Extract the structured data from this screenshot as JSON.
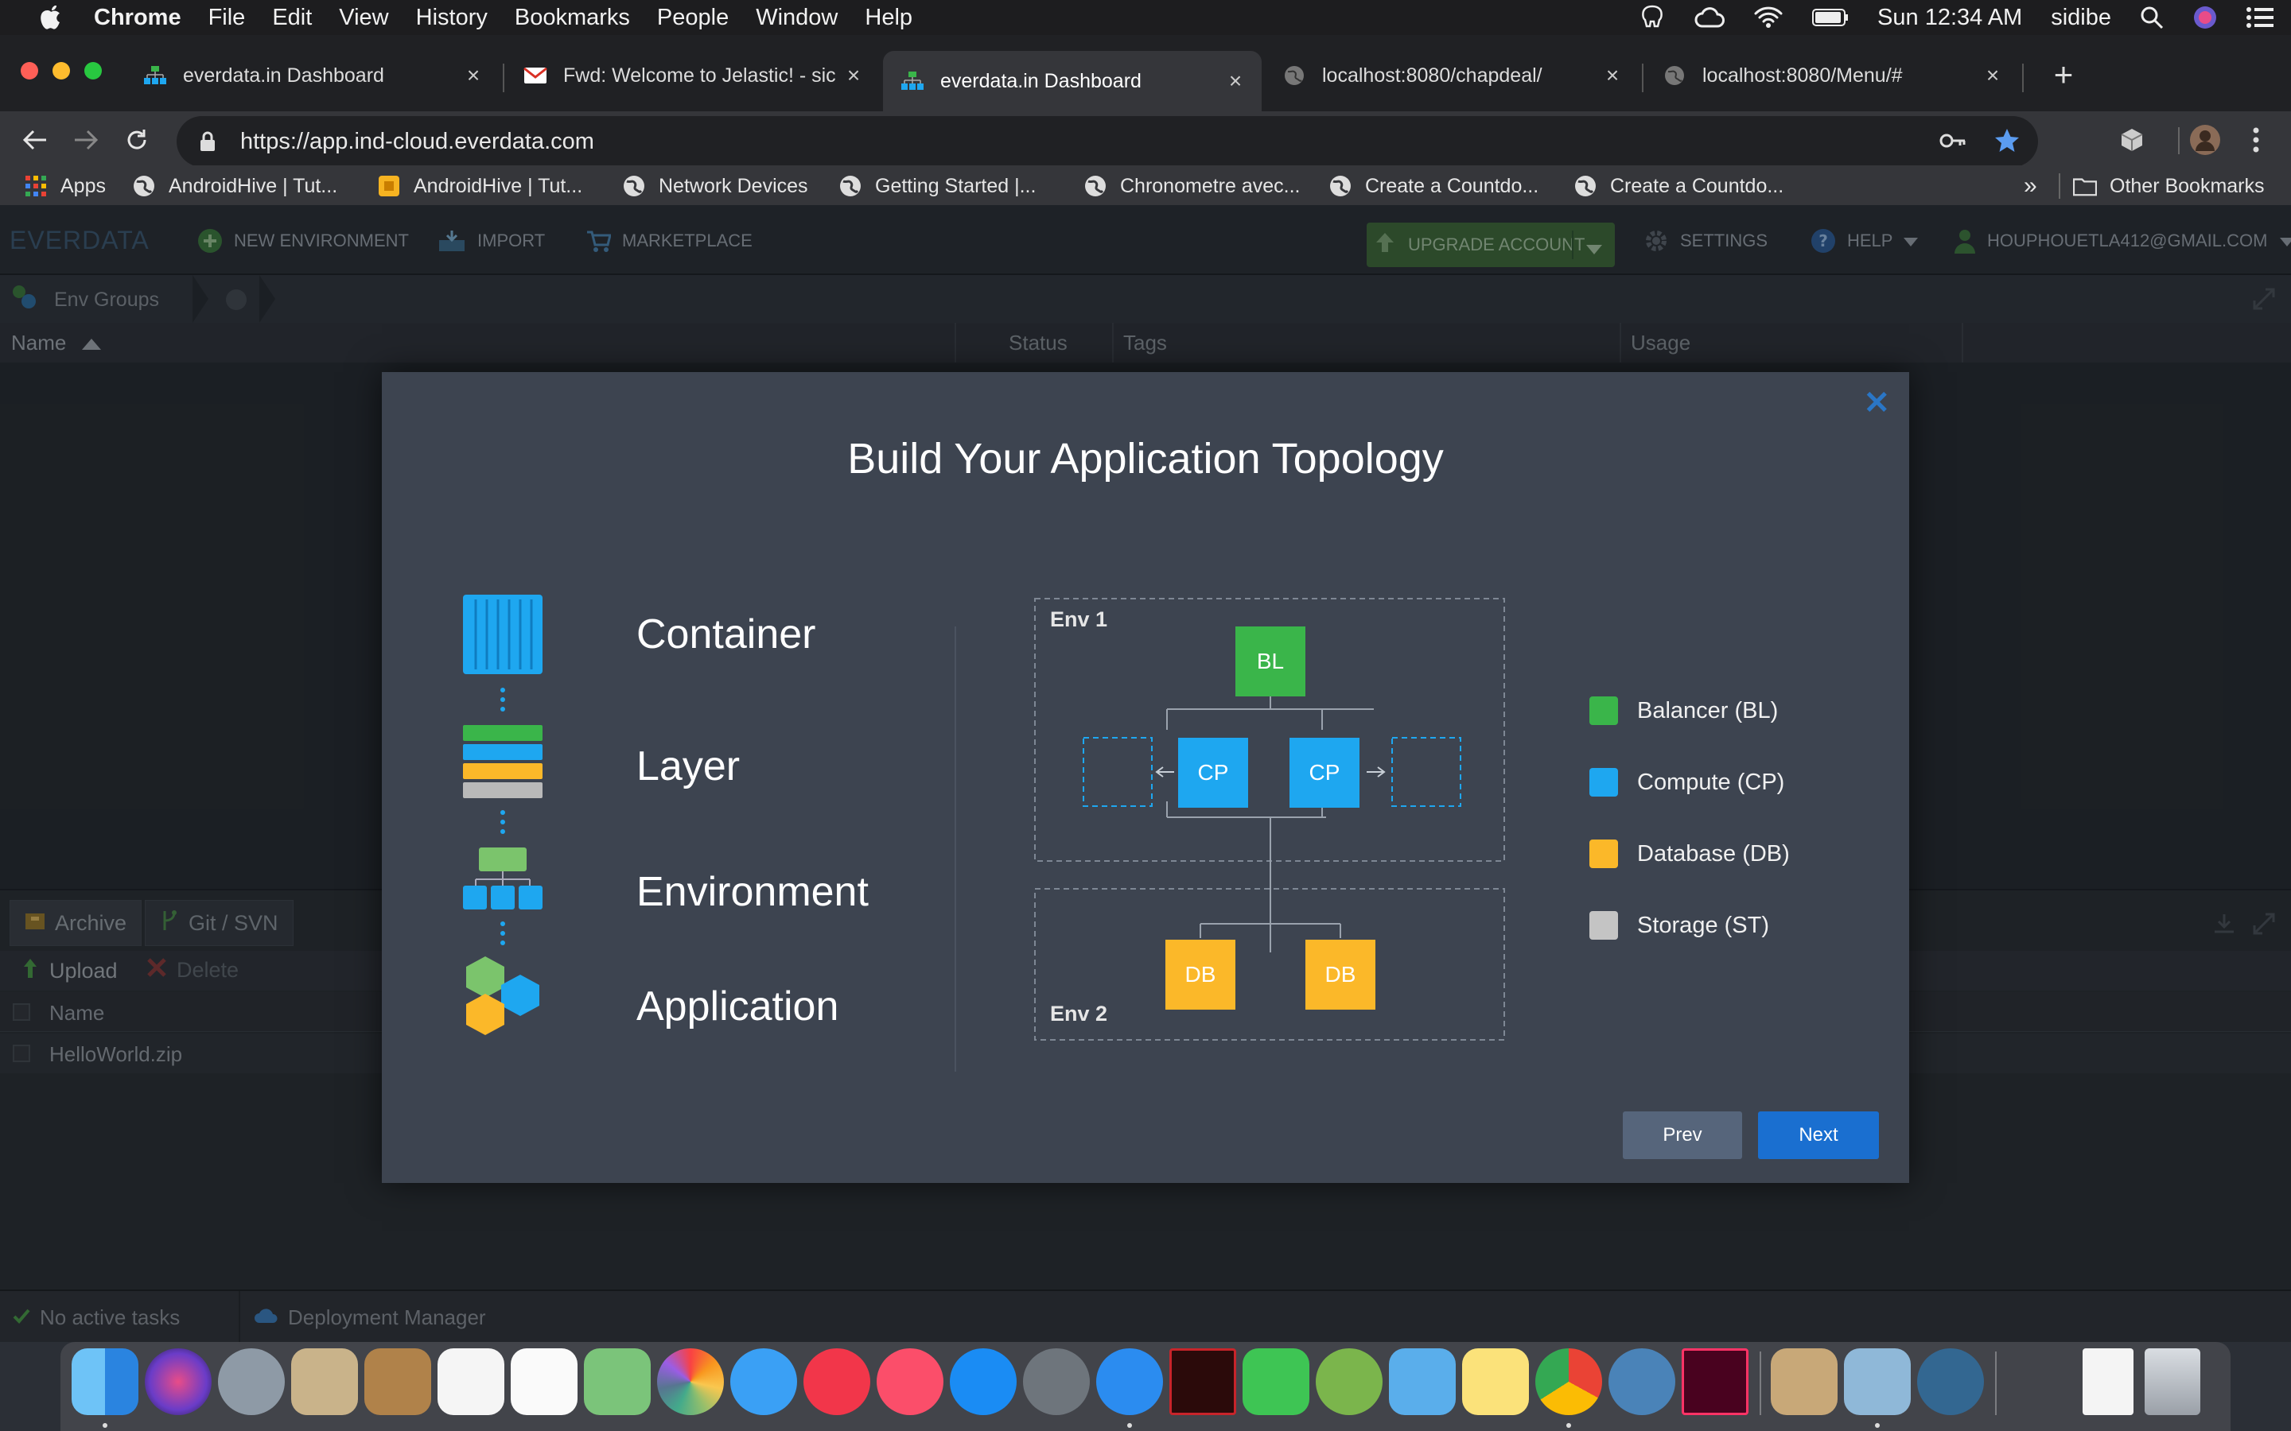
{
  "menubar": {
    "app_name": "Chrome",
    "items": [
      "File",
      "Edit",
      "View",
      "History",
      "Bookmarks",
      "People",
      "Window",
      "Help"
    ],
    "clock": "Sun 12:34 AM",
    "user": "sidibe"
  },
  "tabs": [
    {
      "title": "everdata.in Dashboard",
      "active": false
    },
    {
      "title": "Fwd: Welcome to Jelastic! - sic",
      "active": false
    },
    {
      "title": "everdata.in Dashboard",
      "active": true
    },
    {
      "title": "localhost:8080/chapdeal/",
      "active": false
    },
    {
      "title": "localhost:8080/Menu/#",
      "active": false
    }
  ],
  "new_tab_symbol": "+",
  "address": {
    "url": "https://app.ind-cloud.everdata.com"
  },
  "bookmarks": {
    "items": [
      "Apps",
      "AndroidHive | Tut...",
      "AndroidHive | Tut...",
      "Network Devices",
      "Getting Started |...",
      "Chronometre avec...",
      "Create a Countdo...",
      "Create a Countdo..."
    ],
    "overflow": "»",
    "other": "Other Bookmarks"
  },
  "app": {
    "logo": "EVERDATA",
    "nav": {
      "new_env": "NEW ENVIRONMENT",
      "import": "IMPORT",
      "marketplace": "MARKETPLACE"
    },
    "upgrade": "UPGRADE ACCOUNT",
    "settings": "SETTINGS",
    "help": "HELP",
    "account": "HOUPHOUETLA412@GMAIL.COM",
    "env_groups": "Env Groups",
    "columns": {
      "name": "Name",
      "status": "Status",
      "tags": "Tags",
      "usage": "Usage"
    },
    "panel_tabs": {
      "archive": "Archive",
      "git": "Git / SVN"
    },
    "panel_actions": {
      "upload": "Upload",
      "delete": "Delete"
    },
    "panel_column": "Name",
    "files": [
      "HelloWorld.zip"
    ],
    "status": {
      "tasks": "No active tasks",
      "deployment": "Deployment Manager"
    }
  },
  "modal": {
    "title": "Build Your Application Topology",
    "concepts": [
      "Container",
      "Layer",
      "Environment",
      "Application"
    ],
    "diagram": {
      "env1": "Env 1",
      "env2": "Env 2",
      "bl": "BL",
      "cp": "CP",
      "db": "DB"
    },
    "legend": [
      {
        "label": "Balancer (BL)",
        "color": "#3ab54a"
      },
      {
        "label": "Compute (CP)",
        "color": "#1ea7f0"
      },
      {
        "label": "Database (DB)",
        "color": "#fbb829"
      },
      {
        "label": "Storage (ST)",
        "color": "#c4c4c4"
      }
    ],
    "prev": "Prev",
    "next": "Next"
  },
  "colors": {
    "accent_blue": "#1a6fd0",
    "balancer": "#3ab54a",
    "compute": "#1ea7f0",
    "database": "#fbb829",
    "storage": "#c4c4c4"
  }
}
